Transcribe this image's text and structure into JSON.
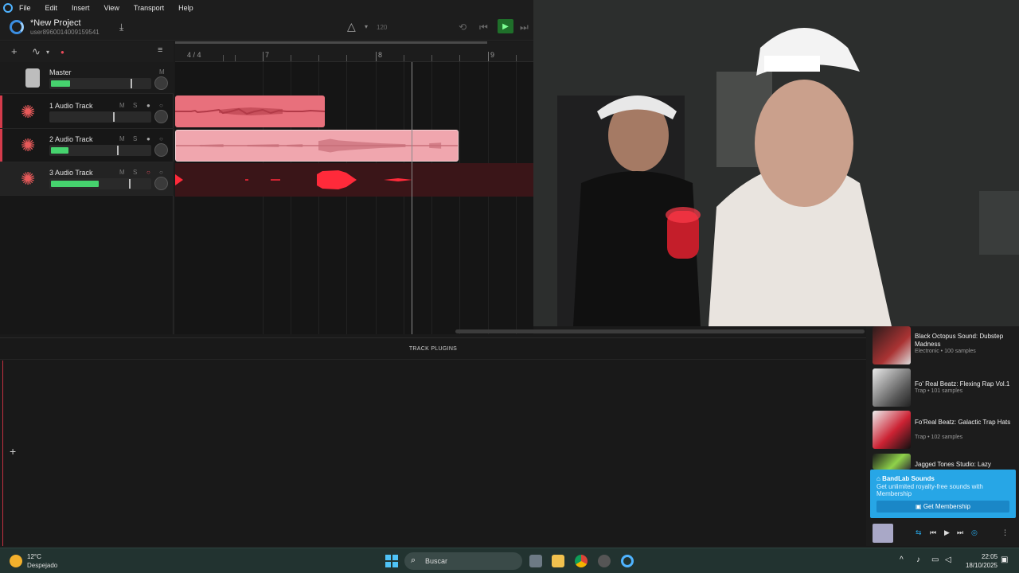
{
  "menu": [
    "File",
    "Edit",
    "Insert",
    "View",
    "Transport",
    "Help"
  ],
  "project": {
    "title": "*New Project",
    "user": "user89600140091595​41"
  },
  "transport": {
    "bpm": "120"
  },
  "ruler": {
    "time_sig": "4 / 4",
    "bars": [
      "7",
      "8",
      "9"
    ]
  },
  "tracks": [
    {
      "name": "Master"
    },
    {
      "name": "1 Audio Track",
      "m": "M",
      "s": "S"
    },
    {
      "name": "2 Audio Track",
      "m": "M",
      "s": "S"
    },
    {
      "name": "3 Audio Track",
      "m": "M",
      "s": "S"
    }
  ],
  "plugins": {
    "header": "TRACK PLUGINS"
  },
  "sounds": [
    {
      "title": "Black Octopus Sound: Dubstep Madness",
      "meta": "Electronic • 100 samples"
    },
    {
      "title": "Fo' Real Beatz: Flexing Rap Vol.1",
      "meta": "Trap • 101 samples"
    },
    {
      "title": "Fo'Real Beatz: Galactic Trap Hats",
      "meta": "Trap • 102 samples"
    },
    {
      "title": "Jagged Tones Studio: Lazy",
      "meta": ""
    }
  ],
  "promo": {
    "title": "BandLab Sounds",
    "desc": "Get unlimited royalty-free sounds with Membership",
    "button": "Get Membership"
  },
  "taskbar": {
    "temp": "12°C",
    "weather": "Despejado",
    "search": "Buscar",
    "time": "22:05",
    "date": "18/10/2025"
  },
  "colors": {
    "accent": "#27a6e6",
    "track": "#e8707c",
    "meter": "#46d36e"
  }
}
